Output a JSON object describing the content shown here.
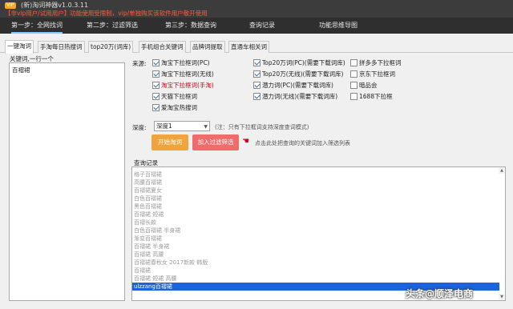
{
  "titlebar": {
    "vip_badge": "VIP",
    "app_title": "(新)淘词神器v1.0.3.11",
    "notice": "【非vip用户/试用用户】功能使用受限制，vip/单独购买该软件用户敬开使用"
  },
  "main_nav": [
    "第一步：全网找词",
    "第二步：过滤筛选",
    "第三步：数据查询",
    "查询记录",
    "功能思维导图"
  ],
  "sub_tabs": [
    "一键淘词",
    "手淘每日热搜词",
    "top20万(词库)",
    "手机组合关键词",
    "品牌词提取",
    "直通车相关词"
  ],
  "left_panel": {
    "label": "关键词,一行一个",
    "keywords": [
      "百褶裙"
    ]
  },
  "sources": {
    "label": "来源:",
    "col1": [
      {
        "label": "淘宝下拉框词(PC)",
        "checked": true,
        "red": false
      },
      {
        "label": "淘宝下拉框词(无线)",
        "checked": true,
        "red": false
      },
      {
        "label": "淘宝下拉框词(手淘)",
        "checked": true,
        "red": true
      },
      {
        "label": "天猫下拉框词",
        "checked": true,
        "red": false
      },
      {
        "label": "爱淘宝热搜词",
        "checked": true,
        "red": false
      }
    ],
    "col2": [
      {
        "label": "Top20万词(PC)(需要下载词库)",
        "checked": true
      },
      {
        "label": "Top20万(无线)(需要下载词库)",
        "checked": true
      },
      {
        "label": "潜力词(PC)(需要下载词库)",
        "checked": true
      },
      {
        "label": "潜力词(无线)(需要下载词库)",
        "checked": true
      }
    ],
    "col3": [
      {
        "label": "拼多多下拉框词",
        "checked": false
      },
      {
        "label": "京东下拉框词",
        "checked": false
      },
      {
        "label": "暗品会",
        "checked": false
      },
      {
        "label": "1688下拉框",
        "checked": false
      }
    ]
  },
  "depth": {
    "label": "深度:",
    "value": "深度1",
    "note": "(注：只有下拉框词支持深度查词模式)"
  },
  "buttons": {
    "start": "开始淘词",
    "filter": "加入过滤筛选",
    "hint": "点击此处把查询的关键词加入筛选列表"
  },
  "history": {
    "label": "查询记录",
    "rows": [
      "格子百褶裙",
      "高腰百褶裙",
      "百褶裙夏女",
      "白色百褶裙",
      "黑色百褶裙",
      "百褶裙 短裙",
      "百褶长款",
      "白色百褶裙 半身裙",
      "渐变百褶裙",
      "百褶裙 半身裙",
      "百褶裙 高腰",
      "百褶裙春秋女 2017新款 韩版",
      "百褶裙",
      "百褶裙 短裙 高腰",
      "ulzzang百褶裙"
    ],
    "selected_index": 14
  },
  "watermark": "头条@顺泽电商",
  "colors": {
    "titlebar": "#3c3c3c",
    "nav": "#2f2f2f",
    "notice": "#ff5a3c",
    "start_button": "#f0a43b",
    "filter_button": "#f06b6b",
    "selection": "#1e64d8"
  }
}
